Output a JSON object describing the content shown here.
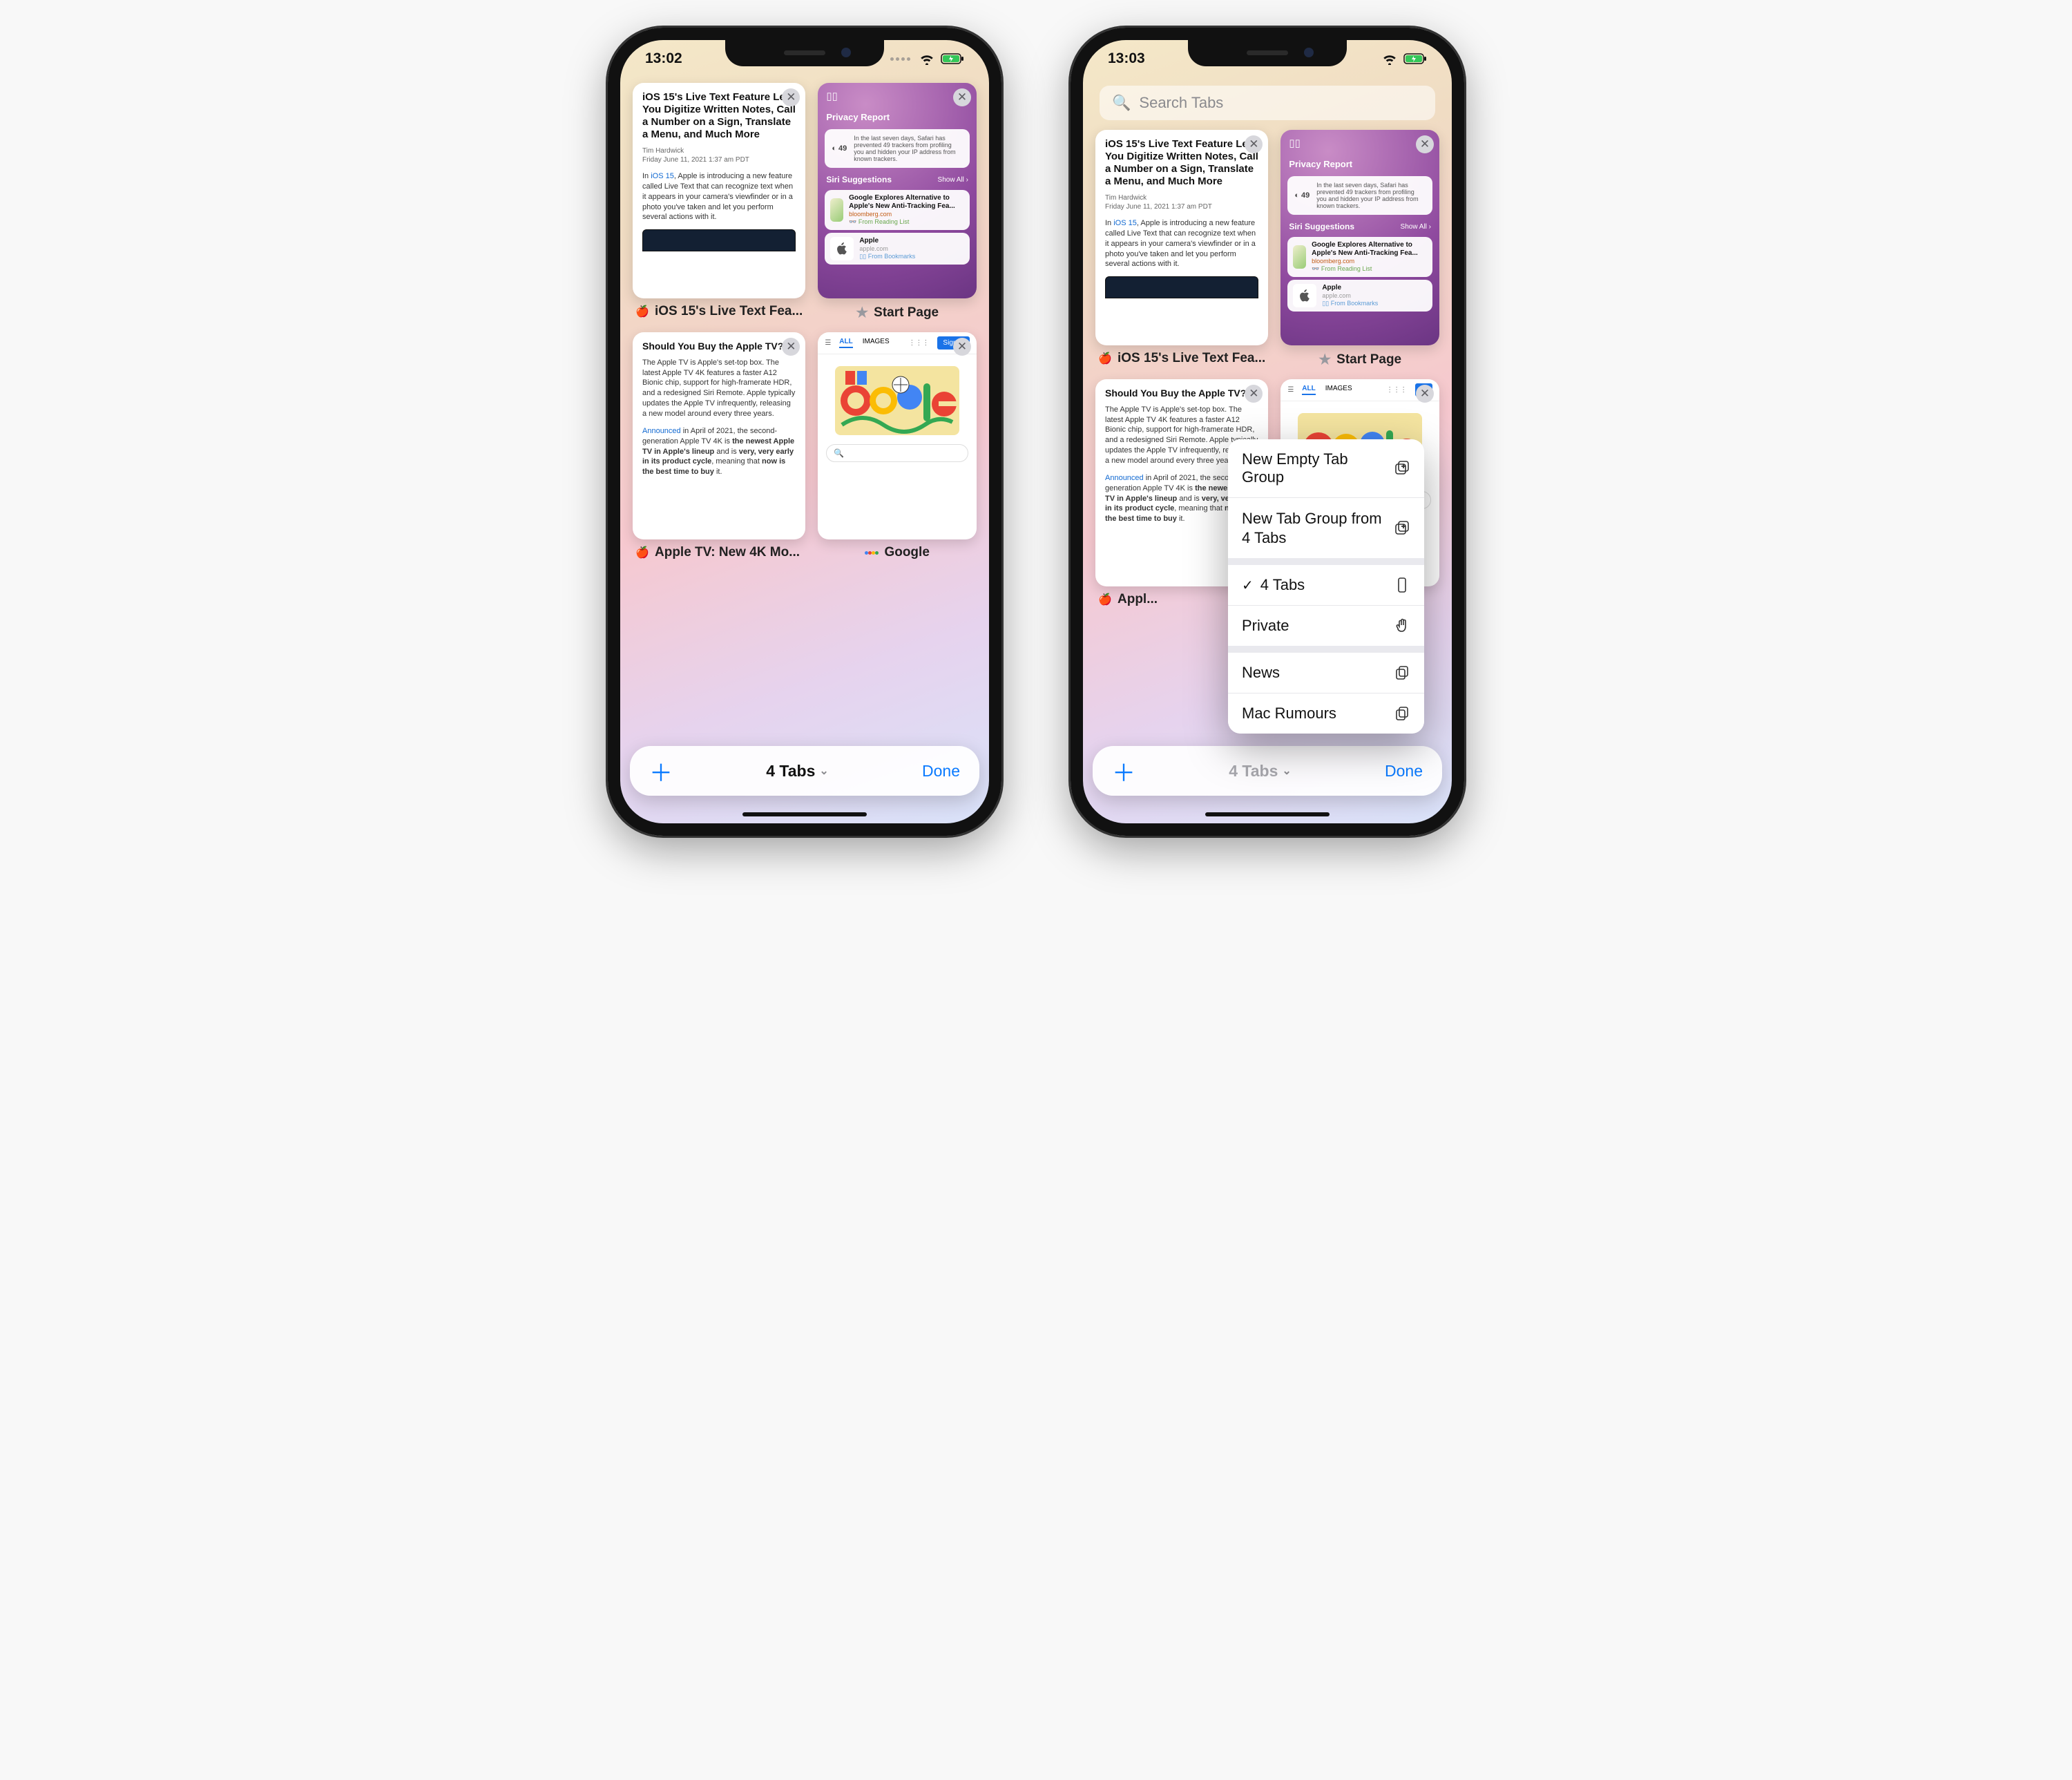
{
  "left": {
    "time": "13:02",
    "tabs": [
      {
        "key": "live_text",
        "title": "iOS 15's Live Text Fea...",
        "article": {
          "headline": "iOS 15's Live Text Feature Lets You Digitize Written Notes, Call a Number on a Sign, Translate a Menu, and Much More",
          "author": "Tim Hardwick",
          "date": "Friday June 11, 2021 1:37 am PDT",
          "body_pre": "In ",
          "body_link": "iOS 15",
          "body_post": ", Apple is introducing a new feature called Live Text that can recognize text when it appears in your camera's viewfinder or in a photo you've taken and let you perform several actions with it."
        }
      },
      {
        "key": "start_page",
        "title": "Start Page",
        "privacy": {
          "label": "Privacy Report",
          "count": "49",
          "text": "In the last seven days, Safari has prevented 49 trackers from profiling you and hidden your IP address from known trackers."
        },
        "siri": {
          "label": "Siri Suggestions",
          "all": "Show All",
          "row1_title": "Google Explores Alternative to Apple's New Anti-Tracking Fea...",
          "row1_domain": "bloomberg.com",
          "row1_src": "From Reading List",
          "row2_title": "Apple",
          "row2_domain": "apple.com",
          "row2_src": "From Bookmarks"
        }
      },
      {
        "key": "apple_tv",
        "title": "Apple TV: New 4K Mo...",
        "article": {
          "headline": "Should You Buy the Apple TV?",
          "p1": "The Apple TV is Apple's set-top box. The latest Apple TV 4K features a faster A12 Bionic chip, support for high-framerate HDR, and a redesigned Siri Remote. Apple typically updates the Apple TV infrequently, releasing a new model around every three years.",
          "p2_link": "Announced",
          "p2_a": " in April of 2021, the second-generation Apple TV 4K is ",
          "p2_b": "the newest Apple TV in Apple's lineup",
          "p2_c": " and is ",
          "p2_d": "very, very early in its product cycle",
          "p2_e": ", meaning that ",
          "p2_f": "now is the best time to buy",
          "p2_g": " it."
        }
      },
      {
        "key": "google",
        "title": "Google",
        "g": {
          "all": "ALL",
          "images": "IMAGES",
          "signin": "Sign in"
        }
      }
    ],
    "bar": {
      "count": "4 Tabs",
      "done": "Done"
    }
  },
  "right": {
    "time": "13:03",
    "search_placeholder": "Search Tabs",
    "bar": {
      "count": "4 Tabs",
      "done": "Done"
    },
    "menu": {
      "new_empty": "New Empty Tab Group",
      "new_from": "New Tab Group from 4 Tabs",
      "current": "4 Tabs",
      "private": "Private",
      "g1": "News",
      "g2": "Mac Rumours"
    }
  }
}
